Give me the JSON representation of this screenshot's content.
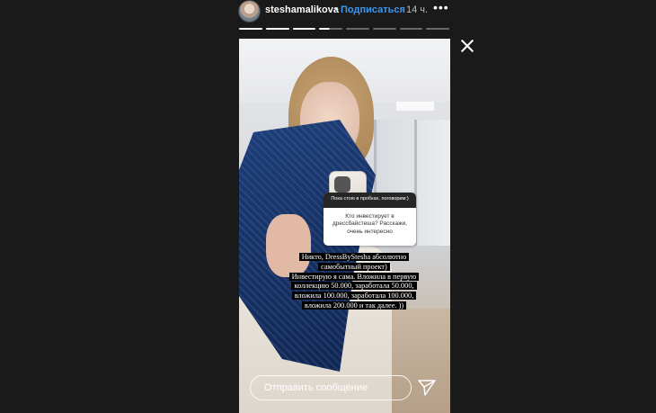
{
  "header": {
    "username": "steshamalikova",
    "separator": "•",
    "follow_label": "Подписаться",
    "time": "14 ч.",
    "more_label": "•••"
  },
  "progress": {
    "total_segments": 8,
    "completed_segments": 3,
    "current_fraction": 0.45
  },
  "story": {
    "question_sticker": {
      "header": "Пока стою в пробках, поговорим:)",
      "question": "Кто инвестирует в дрессбайстеша? Расскажи, очень интересно"
    },
    "answer_lines": [
      "Никто, DressByStesha абсолютно",
      "самобытный проект)",
      "Инвестирую я сама. Вложила в первую",
      "коллекцию 50.000, заработала 50.000,",
      "вложила 100.000, заработала 100.000,",
      "вложила 200.000 и так далее. ))"
    ]
  },
  "reply": {
    "placeholder": "Отправить сообщение"
  },
  "icons": {
    "close": "close-icon",
    "send": "send-icon",
    "more": "more-icon"
  },
  "colors": {
    "background": "#1a1a1a",
    "follow": "#3b97f0"
  }
}
